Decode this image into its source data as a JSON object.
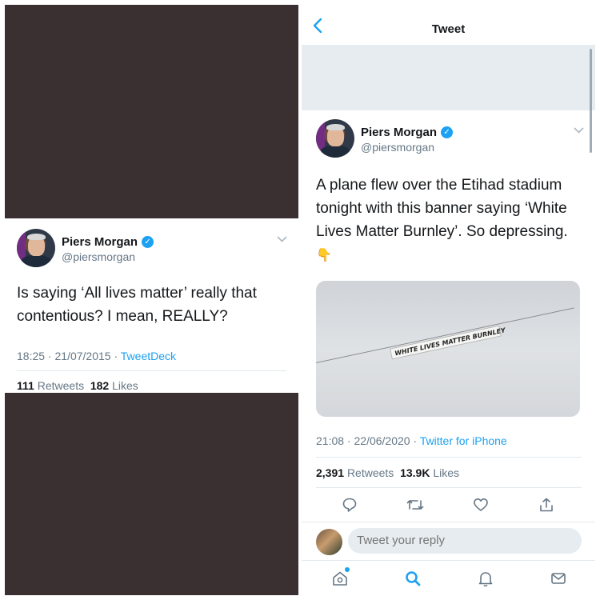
{
  "left_tweet": {
    "name": "Piers Morgan",
    "handle": "@piersmorgan",
    "text": "Is saying ‘All lives matter’ really that contentious? I mean, REALLY?",
    "time": "18:25",
    "date": "21/07/2015",
    "source": "TweetDeck",
    "retweets_count": "111",
    "retweets_label": "Retweets",
    "likes_count": "182",
    "likes_label": "Likes"
  },
  "right_screen": {
    "nav": {
      "title": "Tweet",
      "back_icon": "chevron-left-icon"
    },
    "tweet": {
      "name": "Piers Morgan",
      "handle": "@piersmorgan",
      "text": "A plane flew over the Etihad stadium tonight with this banner saying ‘White Lives Matter Burnley’. So depressing.",
      "emoji": "👇",
      "photo_banner_text": "WHITE LIVES MATTER BURNLEY",
      "time": "21:08",
      "date": "22/06/2020",
      "source": "Twitter for iPhone",
      "retweets_count": "2,391",
      "retweets_label": "Retweets",
      "likes_count": "13.9K",
      "likes_label": "Likes"
    },
    "actions": [
      "reply-icon",
      "retweet-icon",
      "like-icon",
      "share-icon"
    ],
    "reply": {
      "placeholder": "Tweet your reply"
    },
    "tabs": [
      "home-icon",
      "search-icon",
      "notifications-icon",
      "messages-icon"
    ]
  },
  "colors": {
    "accent": "#1da1f2",
    "left_background": "#3b3031",
    "muted_text": "#657786"
  }
}
